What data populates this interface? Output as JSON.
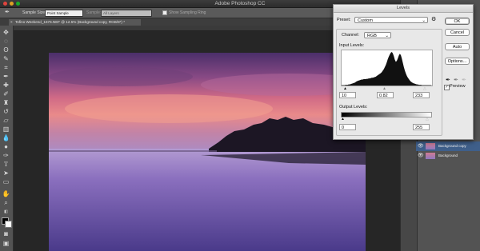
{
  "app": {
    "title": "Adobe Photoshop CC"
  },
  "options_bar": {
    "sample_size_label": "Sample Size:",
    "sample_size_value": "Point Sample",
    "sample_label": "Sample:",
    "sample_value": "All Layers",
    "show_sampling_ring": "Show Sampling Ring"
  },
  "document_tab": {
    "title": "Tofino Weekend_1676.NEF @ 12.5% (Background copy, RGB/8*) *"
  },
  "layers": [
    {
      "name": "Background copy"
    },
    {
      "name": "Background"
    }
  ],
  "levels": {
    "title": "Levels",
    "preset_label": "Preset:",
    "preset_value": "Custom",
    "channel_label": "Channel:",
    "channel_value": "RGB",
    "input_levels_label": "Input Levels:",
    "input_black": "10",
    "input_gamma": "0.82",
    "input_white": "233",
    "output_levels_label": "Output Levels:",
    "output_black": "0",
    "output_white": "255",
    "buttons": {
      "ok": "OK",
      "cancel": "Cancel",
      "auto": "Auto",
      "options": "Options..."
    },
    "preview_label": "Preview",
    "preview_checked": true,
    "histogram": [
      1,
      1,
      1,
      1,
      2,
      2,
      2,
      3,
      3,
      4,
      5,
      6,
      7,
      8,
      10,
      12,
      13,
      14,
      15,
      16,
      17,
      17,
      18,
      18,
      18,
      19,
      19,
      20,
      20,
      21,
      22,
      22,
      23,
      24,
      25,
      27,
      29,
      31,
      33,
      35,
      38,
      42,
      46,
      52,
      58,
      66,
      75,
      82,
      88,
      93,
      95,
      91,
      83,
      73,
      67,
      70,
      77,
      85,
      90,
      86,
      76,
      64,
      52,
      42,
      34,
      27,
      22,
      18,
      14,
      11,
      9,
      7,
      6,
      5,
      4,
      3,
      3,
      2,
      2,
      2,
      1,
      1,
      1,
      1,
      1,
      1,
      1,
      1,
      1,
      1
    ]
  }
}
